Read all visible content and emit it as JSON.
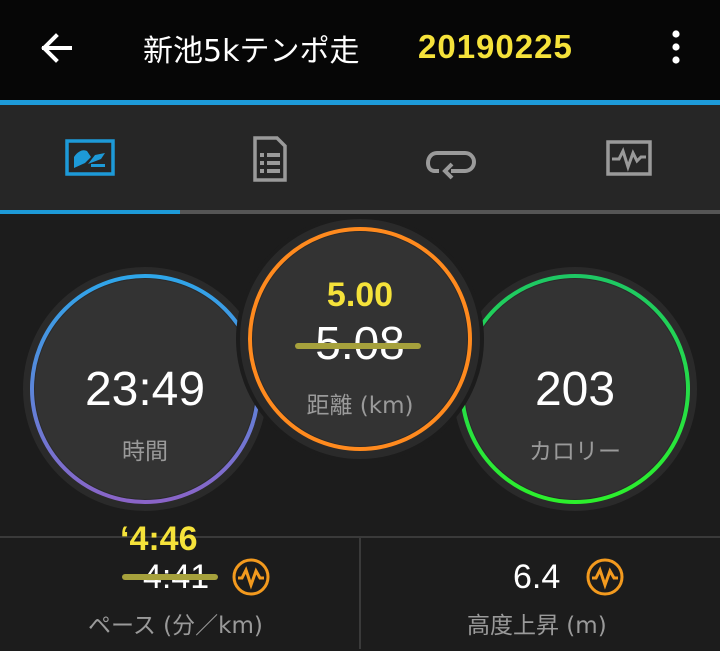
{
  "header": {
    "title": "新池5kテンポ走",
    "date_annotation": "20190225"
  },
  "tabs": [
    {
      "icon": "summary-chart-icon",
      "active": true
    },
    {
      "icon": "details-list-icon",
      "active": false
    },
    {
      "icon": "laps-loop-icon",
      "active": false
    },
    {
      "icon": "graphs-icon",
      "active": false
    }
  ],
  "stats": {
    "time": {
      "value": "23:49",
      "label": "時間"
    },
    "distance": {
      "value": "5.08",
      "corrected": "5.00",
      "label": "距離 (km)"
    },
    "calories": {
      "value": "203",
      "label": "カロリー"
    }
  },
  "bottom": {
    "pace": {
      "value": "4:41",
      "corrected": "‘4:46",
      "label": "ペース (分／km)"
    },
    "elevation": {
      "value": "6.4",
      "label": "高度上昇 (m)"
    }
  },
  "colors": {
    "accent_blue": "#1d9ad8",
    "annotation_yellow": "#f5e23a",
    "distance_ring": "#ff8a1e",
    "calorie_ring": "#22d84a",
    "badge_orange": "#f39a1e"
  }
}
